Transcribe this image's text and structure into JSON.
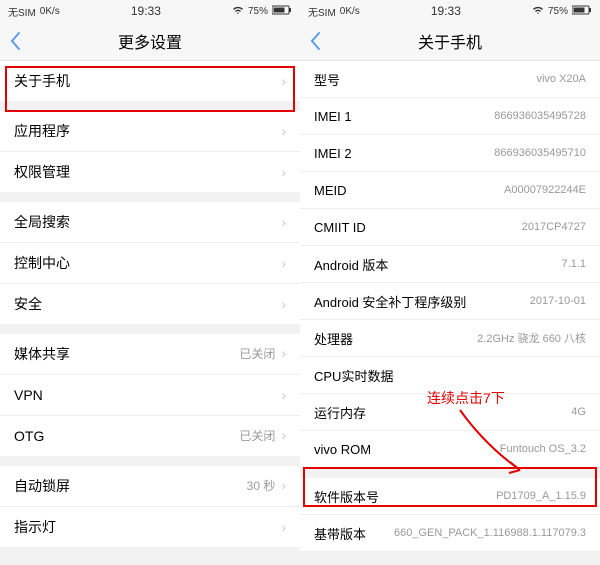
{
  "left": {
    "status": {
      "sim": "无SIM",
      "speed": "0K/s",
      "time": "19:33",
      "batt_pct": "75%"
    },
    "header": {
      "title": "更多设置"
    },
    "groups": [
      [
        {
          "label": "关于手机",
          "value": ""
        }
      ],
      [
        {
          "label": "应用程序",
          "value": ""
        },
        {
          "label": "权限管理",
          "value": ""
        }
      ],
      [
        {
          "label": "全局搜索",
          "value": ""
        },
        {
          "label": "控制中心",
          "value": ""
        },
        {
          "label": "安全",
          "value": ""
        }
      ],
      [
        {
          "label": "媒体共享",
          "value": "已关闭"
        },
        {
          "label": "VPN",
          "value": ""
        },
        {
          "label": "OTG",
          "value": "已关闭"
        }
      ],
      [
        {
          "label": "自动锁屏",
          "value": "30 秒"
        },
        {
          "label": "指示灯",
          "value": ""
        }
      ]
    ]
  },
  "right": {
    "status": {
      "sim": "无SIM",
      "speed": "0K/s",
      "time": "19:33",
      "batt_pct": "75%"
    },
    "header": {
      "title": "关于手机"
    },
    "rows": [
      {
        "label": "型号",
        "value": "vivo X20A"
      },
      {
        "label": "IMEI 1",
        "value": "866936035495728"
      },
      {
        "label": "IMEI 2",
        "value": "866936035495710"
      },
      {
        "label": "MEID",
        "value": "A00007922244E"
      },
      {
        "label": "CMIIT ID",
        "value": "2017CP4727"
      },
      {
        "label": "Android 版本",
        "value": "7.1.1"
      },
      {
        "label": "Android 安全补丁程序级别",
        "value": "2017-10-01"
      },
      {
        "label": "处理器",
        "value": "2.2GHz 骁龙 660 八核"
      },
      {
        "label": "CPU实时数据",
        "value": ""
      },
      {
        "label": "运行内存",
        "value": "4G"
      },
      {
        "label": "vivo ROM",
        "value": "Funtouch OS_3.2"
      },
      {
        "label": "软件版本号",
        "value": "PD1709_A_1.15.9"
      },
      {
        "label": "基带版本",
        "value": "660_GEN_PACK_1.116988.1.117079.3"
      }
    ]
  },
  "annotation": {
    "text": "连续点击7下"
  }
}
